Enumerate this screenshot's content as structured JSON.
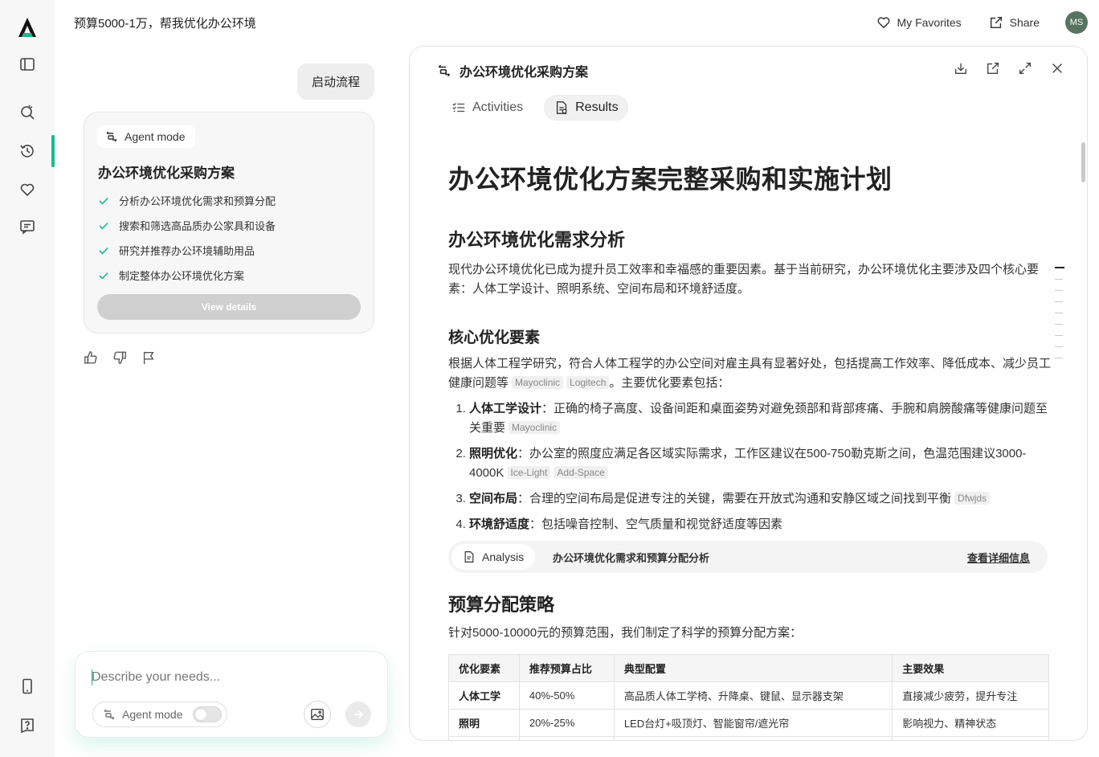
{
  "topbar": {
    "title": "预算5000-1万，帮我优化办公环境",
    "favorites_label": "My Favorites",
    "share_label": "Share",
    "avatar_initials": "MS"
  },
  "sidebar": {
    "icons": [
      "logo-icon",
      "sidebar-toggle-icon",
      "new-search-icon",
      "history-icon",
      "favorites-icon",
      "messages-icon",
      "mobile-icon",
      "help-icon"
    ],
    "accent_color": "#19b98c"
  },
  "chat": {
    "user_message": "启动流程",
    "agent_card": {
      "mode_label": "Agent mode",
      "title": "办公环境优化采购方案",
      "steps": [
        "分析办公环境优化需求和预算分配",
        "搜索和筛选高品质办公家具和设备",
        "研究并推荐办公环境辅助用品",
        "制定整体办公环境优化方案"
      ],
      "view_details_label": "View details"
    }
  },
  "composer": {
    "placeholder": "Describe your needs...",
    "agent_mode_label": "Agent mode"
  },
  "panel": {
    "title": "办公环境优化采购方案",
    "tabs": {
      "activities": "Activities",
      "results": "Results"
    },
    "doc": {
      "h1": "办公环境优化方案完整采购和实施计划",
      "s1_title": "办公环境优化需求分析",
      "s1_text": "现代办公环境优化已成为提升员工效率和幸福感的重要因素。基于当前研究，办公环境优化主要涉及四个核心要素：人体工学设计、照明系统、空间布局和环境舒适度。",
      "s2_title": "核心优化要素",
      "s2_text": "根据人体工程学研究，符合人体工程学的办公空间对雇主具有显著好处，包括提高工作效率、降低成本、减少员工健康问题等",
      "s2_cites": [
        "Mayoclinic",
        "Logitech"
      ],
      "s2_tail": "。主要优化要素包括：",
      "list": [
        {
          "bold": "人体工学设计",
          "text": "：正确的椅子高度、设备间距和桌面姿势对避免颈部和背部疼痛、手腕和肩膀酸痛等健康问题至关重要",
          "cites": [
            "Mayoclinic"
          ]
        },
        {
          "bold": "照明优化",
          "text": "：办公室的照度应满足各区域实际需求，工作区建议在500-750勒克斯之间，色温范围建议3000-4000K",
          "cites": [
            "Ice-Light",
            "Add-Space"
          ]
        },
        {
          "bold": "空间布局",
          "text": "：合理的空间布局是促进专注的关键，需要在开放式沟通和安静区域之间找到平衡",
          "cites": [
            "Dfwjds"
          ]
        },
        {
          "bold": "环境舒适度",
          "text": "：包括噪音控制、空气质量和视觉舒适度等因素",
          "cites": []
        }
      ],
      "analysis": {
        "chip_label": "Analysis",
        "title": "办公环境优化需求和预算分配分析",
        "link": "查看详细信息"
      },
      "s3_title": "预算分配策略",
      "s3_text": "针对5000-10000元的预算范围，我们制定了科学的预算分配方案：",
      "table": {
        "headers": [
          "优化要素",
          "推荐预算占比",
          "典型配置",
          "主要效果"
        ],
        "rows": [
          [
            "人体工学",
            "40%-50%",
            "高品质人体工学椅、升降桌、键鼠、显示器支架",
            "直接减少疲劳，提升专注"
          ],
          [
            "照明",
            "20%-25%",
            "LED台灯+吸顶灯、智能窗帘/遮光帘",
            "影响视力、精神状态"
          ]
        ]
      }
    }
  }
}
